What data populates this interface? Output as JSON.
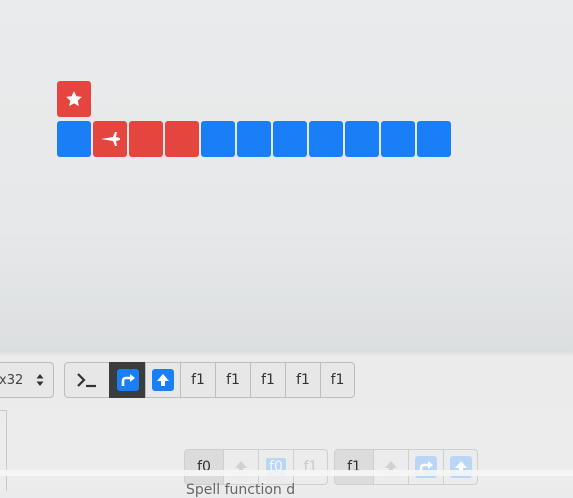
{
  "colors": {
    "blue": "#1a7ef7",
    "red": "#e5453f",
    "selected_dark": "#3a3d40"
  },
  "board": {
    "star_tile": {
      "color": "red",
      "icon": "star-icon"
    },
    "row": [
      {
        "color": "blue"
      },
      {
        "color": "red",
        "icon": "plane-icon"
      },
      {
        "color": "red"
      },
      {
        "color": "red"
      },
      {
        "color": "blue"
      },
      {
        "color": "blue"
      },
      {
        "color": "blue"
      },
      {
        "color": "blue"
      },
      {
        "color": "blue"
      },
      {
        "color": "blue"
      },
      {
        "color": "blue"
      }
    ]
  },
  "toolbar": {
    "size_select_value": "x32",
    "terminal_icon": "terminal-icon",
    "forward_icon": "turn-right-icon",
    "up_icon": "arrow-up-icon",
    "function_labels": [
      "f1",
      "f1",
      "f1",
      "f1",
      "f1"
    ]
  },
  "functions_row": {
    "f0_label": "f0",
    "f0_faded_label": "f0",
    "f1_faded_label": "f1",
    "f1_label": "f1"
  },
  "cut_off_text": "Spell function d"
}
